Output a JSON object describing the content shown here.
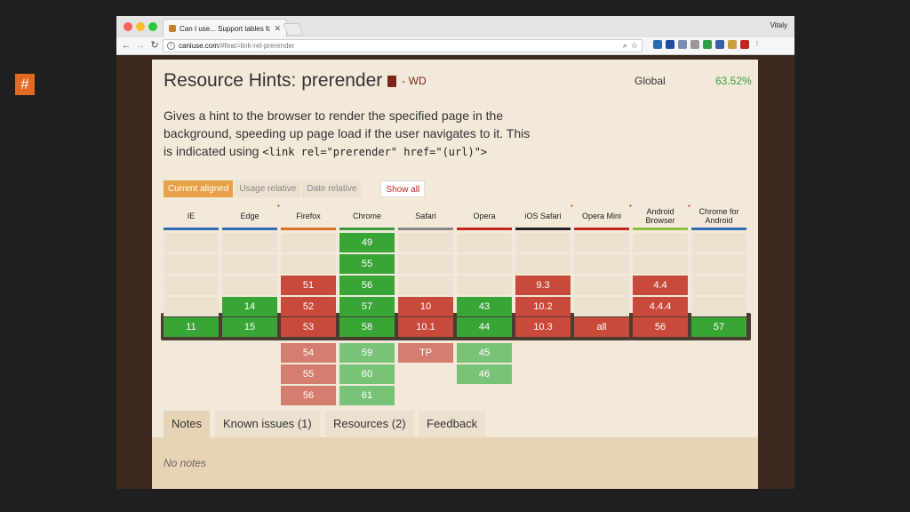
{
  "browser": {
    "tab_title": "Can I use... Support tables fo",
    "tab_close": "✕",
    "user": "Vitaly",
    "url_host": "caniuse.com",
    "url_path": "/#feat=link-rel-prerender"
  },
  "feature": {
    "title": "Resource Hints: prerender",
    "status": "- WD",
    "global_label": "Global",
    "global_value": "63.52%",
    "desc_1": "Gives a hint to the browser to render the specified page in the",
    "desc_2": "background, speeding up page load if the user navigates to it. This",
    "desc_3": "is indicated using",
    "desc_code": "<link rel=\"prerender\" href=\"(url)\">"
  },
  "filters": {
    "current": "Current aligned",
    "usage": "Usage relative",
    "date": "Date relative",
    "show_all": "Show all"
  },
  "browsers": [
    {
      "name": "IE",
      "star": "",
      "color": "#2f6db5"
    },
    {
      "name": "Edge",
      "star": "*",
      "color": "#2f6db5"
    },
    {
      "name": "Firefox",
      "star": "",
      "color": "#d9702a"
    },
    {
      "name": "Chrome",
      "star": "",
      "color": "#3b9c3b"
    },
    {
      "name": "Safari",
      "star": "",
      "color": "#888888"
    },
    {
      "name": "Opera",
      "star": "",
      "color": "#c4261d"
    },
    {
      "name": "iOS Safari",
      "star": "*",
      "color": "#222222"
    },
    {
      "name": "Opera Mini",
      "star": "*",
      "color": "#c4261d"
    },
    {
      "name": "Android Browser",
      "star": "*",
      "color": "#8cbf3f"
    },
    {
      "name": "Chrome for Android",
      "star": "",
      "color": "#2f6db5"
    }
  ],
  "support": {
    "past": [
      [
        "",
        "",
        "",
        "49",
        "",
        "",
        "",
        "",
        "",
        ""
      ],
      [
        "",
        "",
        "",
        "55",
        "",
        "",
        "",
        "",
        "",
        ""
      ],
      [
        "",
        "",
        "51",
        "56",
        "",
        "",
        "9.3",
        "",
        "4.4",
        ""
      ],
      [
        "",
        "14",
        "52",
        "57",
        "10",
        "43",
        "10.2",
        "",
        "4.4.4",
        ""
      ]
    ],
    "past_state": [
      [
        "",
        "",
        "",
        "y",
        "",
        "",
        "",
        "",
        "",
        ""
      ],
      [
        "",
        "",
        "",
        "y",
        "",
        "",
        "",
        "",
        "",
        ""
      ],
      [
        "",
        "",
        "n",
        "y",
        "",
        "",
        "n",
        "",
        "n",
        ""
      ],
      [
        "",
        "y",
        "n",
        "y",
        "n",
        "y",
        "n",
        "",
        "n",
        ""
      ]
    ],
    "current": [
      "11",
      "15",
      "53",
      "58",
      "10.1",
      "44",
      "10.3",
      "all",
      "56",
      "57"
    ],
    "current_state": [
      "y",
      "y",
      "n",
      "y",
      "n",
      "y",
      "n",
      "n",
      "n",
      "y"
    ],
    "future": [
      [
        "",
        "",
        "54",
        "59",
        "TP",
        "45",
        "",
        "",
        "",
        ""
      ],
      [
        "",
        "",
        "55",
        "60",
        "",
        "46",
        "",
        "",
        "",
        ""
      ],
      [
        "",
        "",
        "56",
        "61",
        "",
        "",
        "",
        "",
        "",
        ""
      ]
    ],
    "future_state": [
      [
        "",
        "",
        "n",
        "y",
        "n",
        "y",
        "",
        "",
        "",
        ""
      ],
      [
        "",
        "",
        "n",
        "y",
        "",
        "y",
        "",
        "",
        "",
        ""
      ],
      [
        "",
        "",
        "n",
        "y",
        "",
        "",
        "",
        "",
        "",
        ""
      ]
    ]
  },
  "info_tabs": {
    "notes": "Notes",
    "known_issues": "Known issues (1)",
    "resources": "Resources (2)",
    "feedback": "Feedback"
  },
  "notes_text": "No notes"
}
